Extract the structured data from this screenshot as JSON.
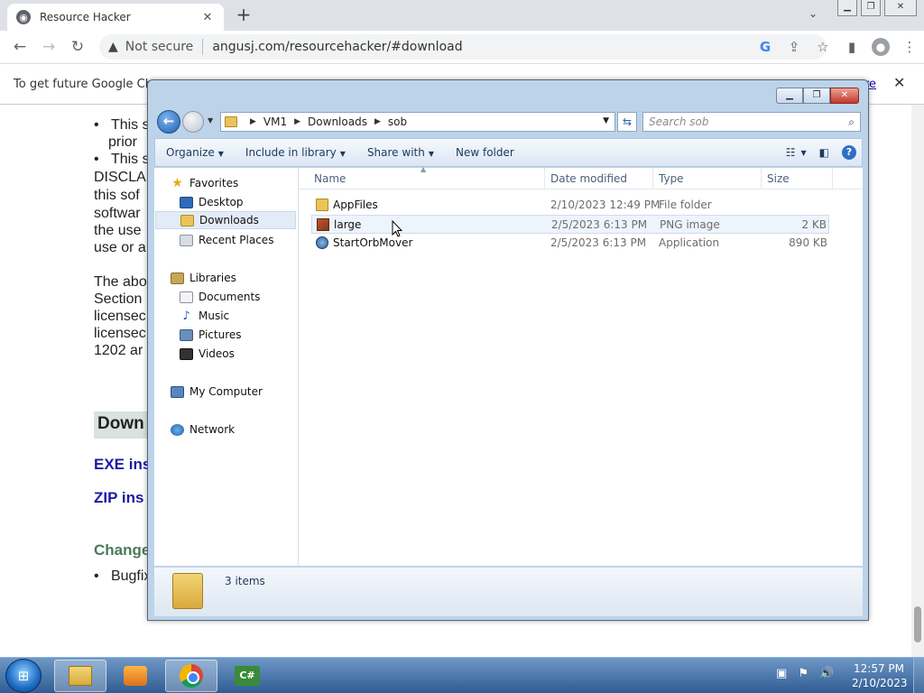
{
  "browser": {
    "tab_title": "Resource Hacker",
    "tab_close": "✕",
    "new_tab": "+",
    "tab_list": "⌄",
    "not_secure": "Not secure",
    "url": "angusj.com/resourcehacker/#download",
    "info_message": "To get future Google Chro",
    "info_link": "re",
    "info_close": "✕"
  },
  "page": {
    "bullet1_line1": "This s",
    "bullet1_line2": "prior",
    "bullet2": "This s",
    "disclaimer_lines": [
      "DISCLA",
      "this sof",
      "softwar",
      "the use",
      "use or a"
    ],
    "para_lines": [
      "The abo",
      "Section",
      "licensec",
      "licensec",
      "1202 ar"
    ],
    "download_heading": "Down",
    "exe_link": "EXE ins",
    "zip_link": "ZIP ins",
    "changes_heading": "Change",
    "changes_bullet": "Bugfix"
  },
  "explorer": {
    "breadcrumb": [
      "VM1",
      "Downloads",
      "sob"
    ],
    "search_placeholder": "Search sob",
    "toolbar": {
      "organize": "Organize",
      "include_in_library": "Include in library",
      "share_with": "Share with",
      "new_folder": "New folder"
    },
    "nav": {
      "favorites": "Favorites",
      "desktop": "Desktop",
      "downloads": "Downloads",
      "recent_places": "Recent Places",
      "libraries": "Libraries",
      "documents": "Documents",
      "music": "Music",
      "pictures": "Pictures",
      "videos": "Videos",
      "my_computer": "My Computer",
      "network": "Network"
    },
    "columns": {
      "name": "Name",
      "date_modified": "Date modified",
      "type": "Type",
      "size": "Size"
    },
    "files": [
      {
        "name": "AppFiles",
        "date": "2/10/2023 12:49 PM",
        "type": "File folder",
        "size": ""
      },
      {
        "name": "large",
        "date": "2/5/2023 6:13 PM",
        "type": "PNG image",
        "size": "2 KB"
      },
      {
        "name": "StartOrbMover",
        "date": "2/5/2023 6:13 PM",
        "type": "Application",
        "size": "890 KB"
      }
    ],
    "status": "3 items"
  },
  "taskbar": {
    "time": "12:57 PM",
    "date": "2/10/2023"
  },
  "colors": {
    "chrome_tabbar": "#dee1e6",
    "explorer_frame": "#bcd3ea",
    "taskbar": "#2f5c93",
    "link_blue": "#1a1aa6",
    "heading_green": "#4a7a5a"
  }
}
